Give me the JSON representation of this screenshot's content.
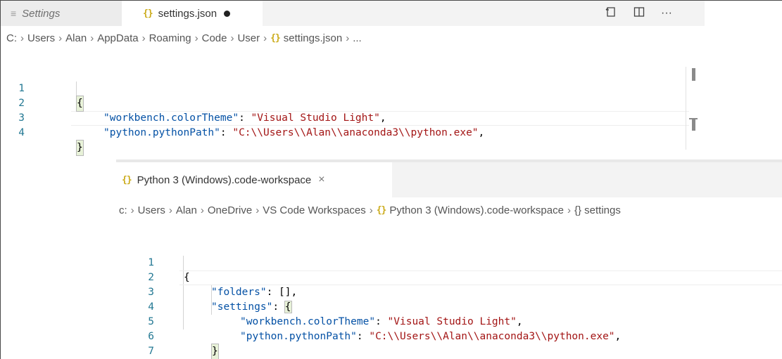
{
  "editor1": {
    "tabs": [
      {
        "label": "Settings",
        "icon": "settings-icon",
        "active": false
      },
      {
        "label": "settings.json",
        "icon": "json-braces-icon",
        "active": true,
        "dirty": true
      }
    ],
    "toolbar_icons": [
      "open-settings-json-icon",
      "split-editor-icon",
      "more-actions-icon"
    ],
    "toolbar_more_label": "···",
    "breadcrumb": [
      "C:",
      "Users",
      "Alan",
      "AppData",
      "Roaming",
      "Code",
      "User",
      "settings.json",
      "..."
    ],
    "lines": [
      {
        "n": "1",
        "text": "{"
      },
      {
        "n": "2",
        "key": "\"workbench.colorTheme\"",
        "value": "\"Visual Studio Light\"",
        "trail": ","
      },
      {
        "n": "3",
        "key": "\"python.pythonPath\"",
        "value": "\"C:\\\\Users\\\\Alan\\\\anaconda3\\\\python.exe\"",
        "trail": ","
      },
      {
        "n": "4",
        "text": "}"
      }
    ]
  },
  "editor2": {
    "tab": {
      "label": "Python 3 (Windows).code-workspace",
      "icon": "json-braces-icon",
      "close": "×"
    },
    "breadcrumb": [
      "c:",
      "Users",
      "Alan",
      "OneDrive",
      "VS Code Workspaces",
      "Python 3 (Windows).code-workspace",
      "{} settings"
    ],
    "lines": [
      {
        "n": "1",
        "text": "{"
      },
      {
        "n": "2",
        "key": "\"folders\"",
        "value": "[]",
        "trail": ","
      },
      {
        "n": "3",
        "key": "\"settings\"",
        "value": "{",
        "trail": ""
      },
      {
        "n": "4",
        "key": "\"workbench.colorTheme\"",
        "value": "\"Visual Studio Light\"",
        "trail": ","
      },
      {
        "n": "5",
        "key": "\"python.pythonPath\"",
        "value": "\"C:\\\\Users\\\\Alan\\\\anaconda3\\\\python.exe\"",
        "trail": ","
      },
      {
        "n": "6",
        "text": "}"
      },
      {
        "n": "7",
        "text": "}"
      }
    ]
  },
  "colors": {
    "json_icon": "#cbab1a",
    "line_number": "#237893",
    "json_key": "#0451a5",
    "json_string": "#a31515",
    "tab_bar": "#f3f3f3"
  }
}
